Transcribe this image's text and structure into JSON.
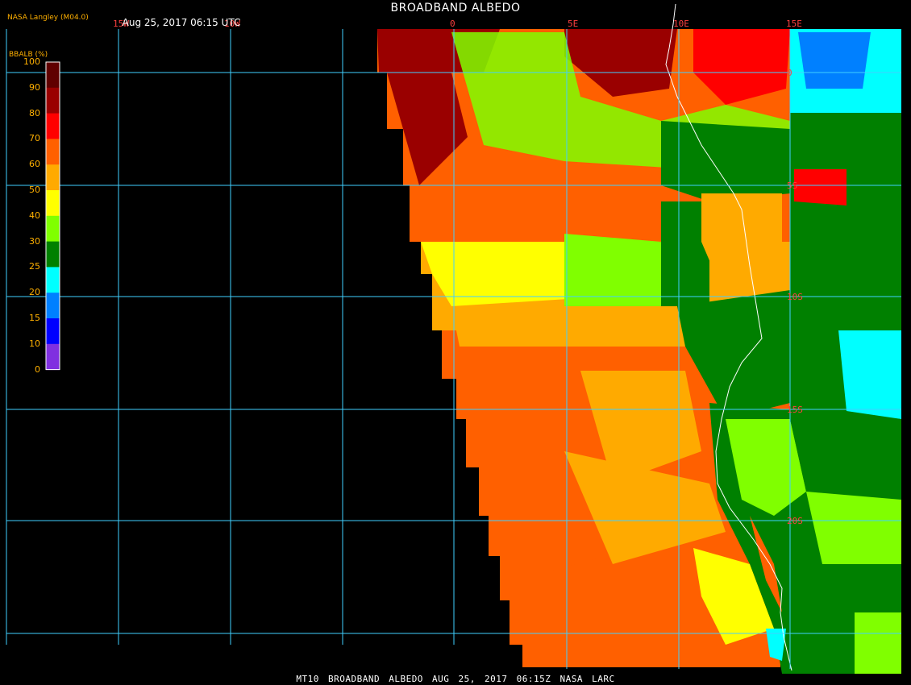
{
  "header": {
    "title": "BROADBAND ALBEDO",
    "timestamp": "Aug 25, 2017 06:15 UTC",
    "provider": "NASA Langley (M04.0)"
  },
  "legend": {
    "title": "BBALB (%)",
    "levels": [
      {
        "label": "100",
        "value": 100,
        "color": "#600000"
      },
      {
        "label": "90",
        "value": 90,
        "color": "#9a0000"
      },
      {
        "label": "80",
        "value": 80,
        "color": "#ff0000"
      },
      {
        "label": "70",
        "value": 70,
        "color": "#ff6000"
      },
      {
        "label": "60",
        "value": 60,
        "color": "#ffaa00"
      },
      {
        "label": "50",
        "value": 50,
        "color": "#ffff00"
      },
      {
        "label": "40",
        "value": 40,
        "color": "#80ff00"
      },
      {
        "label": "30",
        "value": 30,
        "color": "#008000"
      },
      {
        "label": "25",
        "value": 25,
        "color": "#00ffff"
      },
      {
        "label": "20",
        "value": 20,
        "color": "#0080ff"
      },
      {
        "label": "15",
        "value": 15,
        "color": "#0000ff"
      },
      {
        "label": "10",
        "value": 10,
        "color": "#8030e0"
      },
      {
        "label": "0",
        "value": 0,
        "color": "#8030e0"
      }
    ]
  },
  "grid": {
    "color": "#40d0ff",
    "lon_labels": [
      "15W",
      "10W",
      "0",
      "5E",
      "10E",
      "15E"
    ],
    "lat_labels": [
      "0",
      "5S",
      "10S",
      "15S",
      "20S"
    ]
  },
  "footer": "MT10  BROADBAND ALBEDO   AUG 25, 2017 06:15Z   NASA LARC"
}
